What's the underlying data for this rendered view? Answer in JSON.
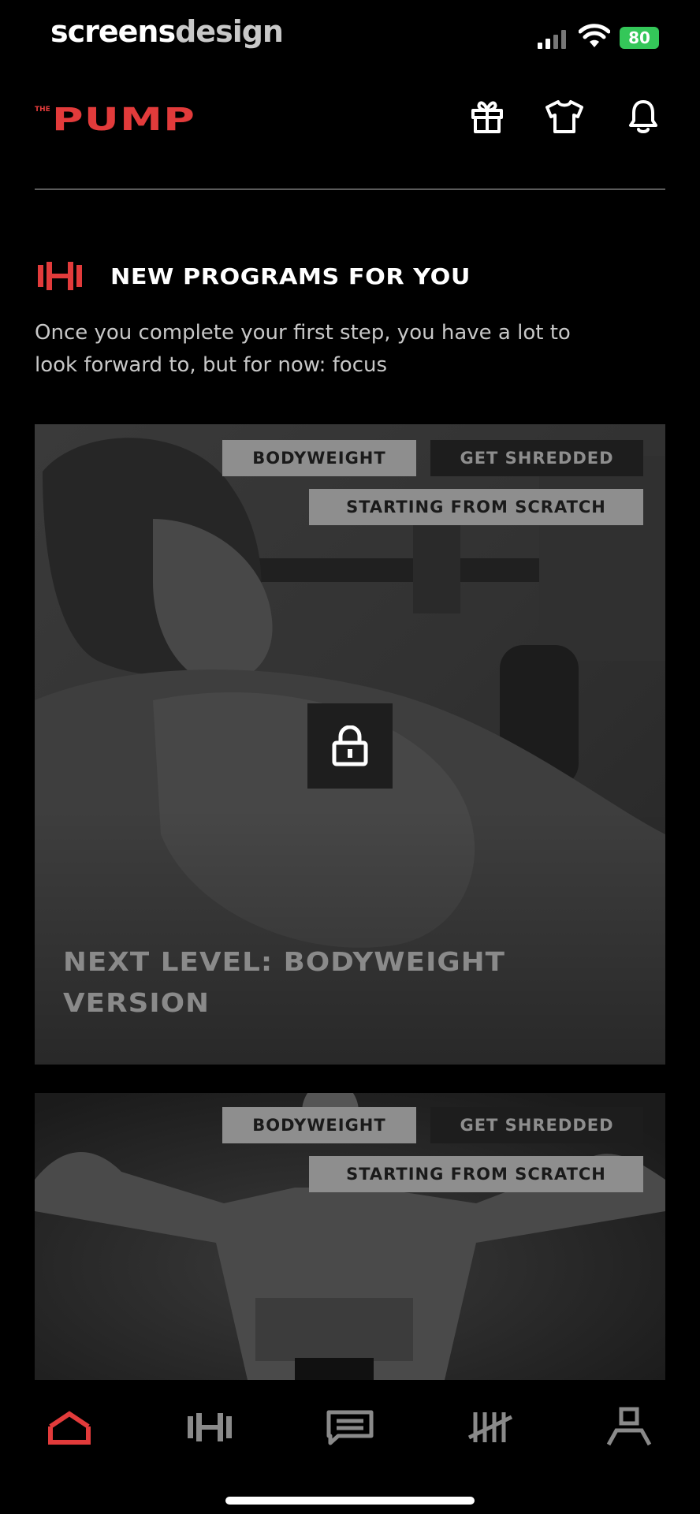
{
  "status": {
    "watermark_a": "screens",
    "watermark_b": "design",
    "battery": "80"
  },
  "header": {
    "logo_small": "THE",
    "logo_main": "PUMP",
    "icons": [
      "gift-icon",
      "tshirt-icon",
      "bell-icon"
    ]
  },
  "section": {
    "title": "NEW PROGRAMS FOR YOU",
    "description": "Once you complete your first step, you have a lot to look forward to, but for now: focus"
  },
  "cards": [
    {
      "tags": [
        "BODYWEIGHT",
        "GET SHREDDED",
        "STARTING FROM SCRATCH"
      ],
      "title": "NEXT LEVEL: BODYWEIGHT VERSION",
      "locked": true
    },
    {
      "tags": [
        "BODYWEIGHT",
        "GET SHREDDED",
        "STARTING FROM SCRATCH"
      ]
    }
  ],
  "nav": {
    "items": [
      "home-icon",
      "dumbbell-icon",
      "chat-icon",
      "tally-icon",
      "profile-icon"
    ],
    "active_index": 0
  },
  "colors": {
    "accent": "#e23b3b",
    "background": "#000000",
    "battery": "#34c759"
  }
}
